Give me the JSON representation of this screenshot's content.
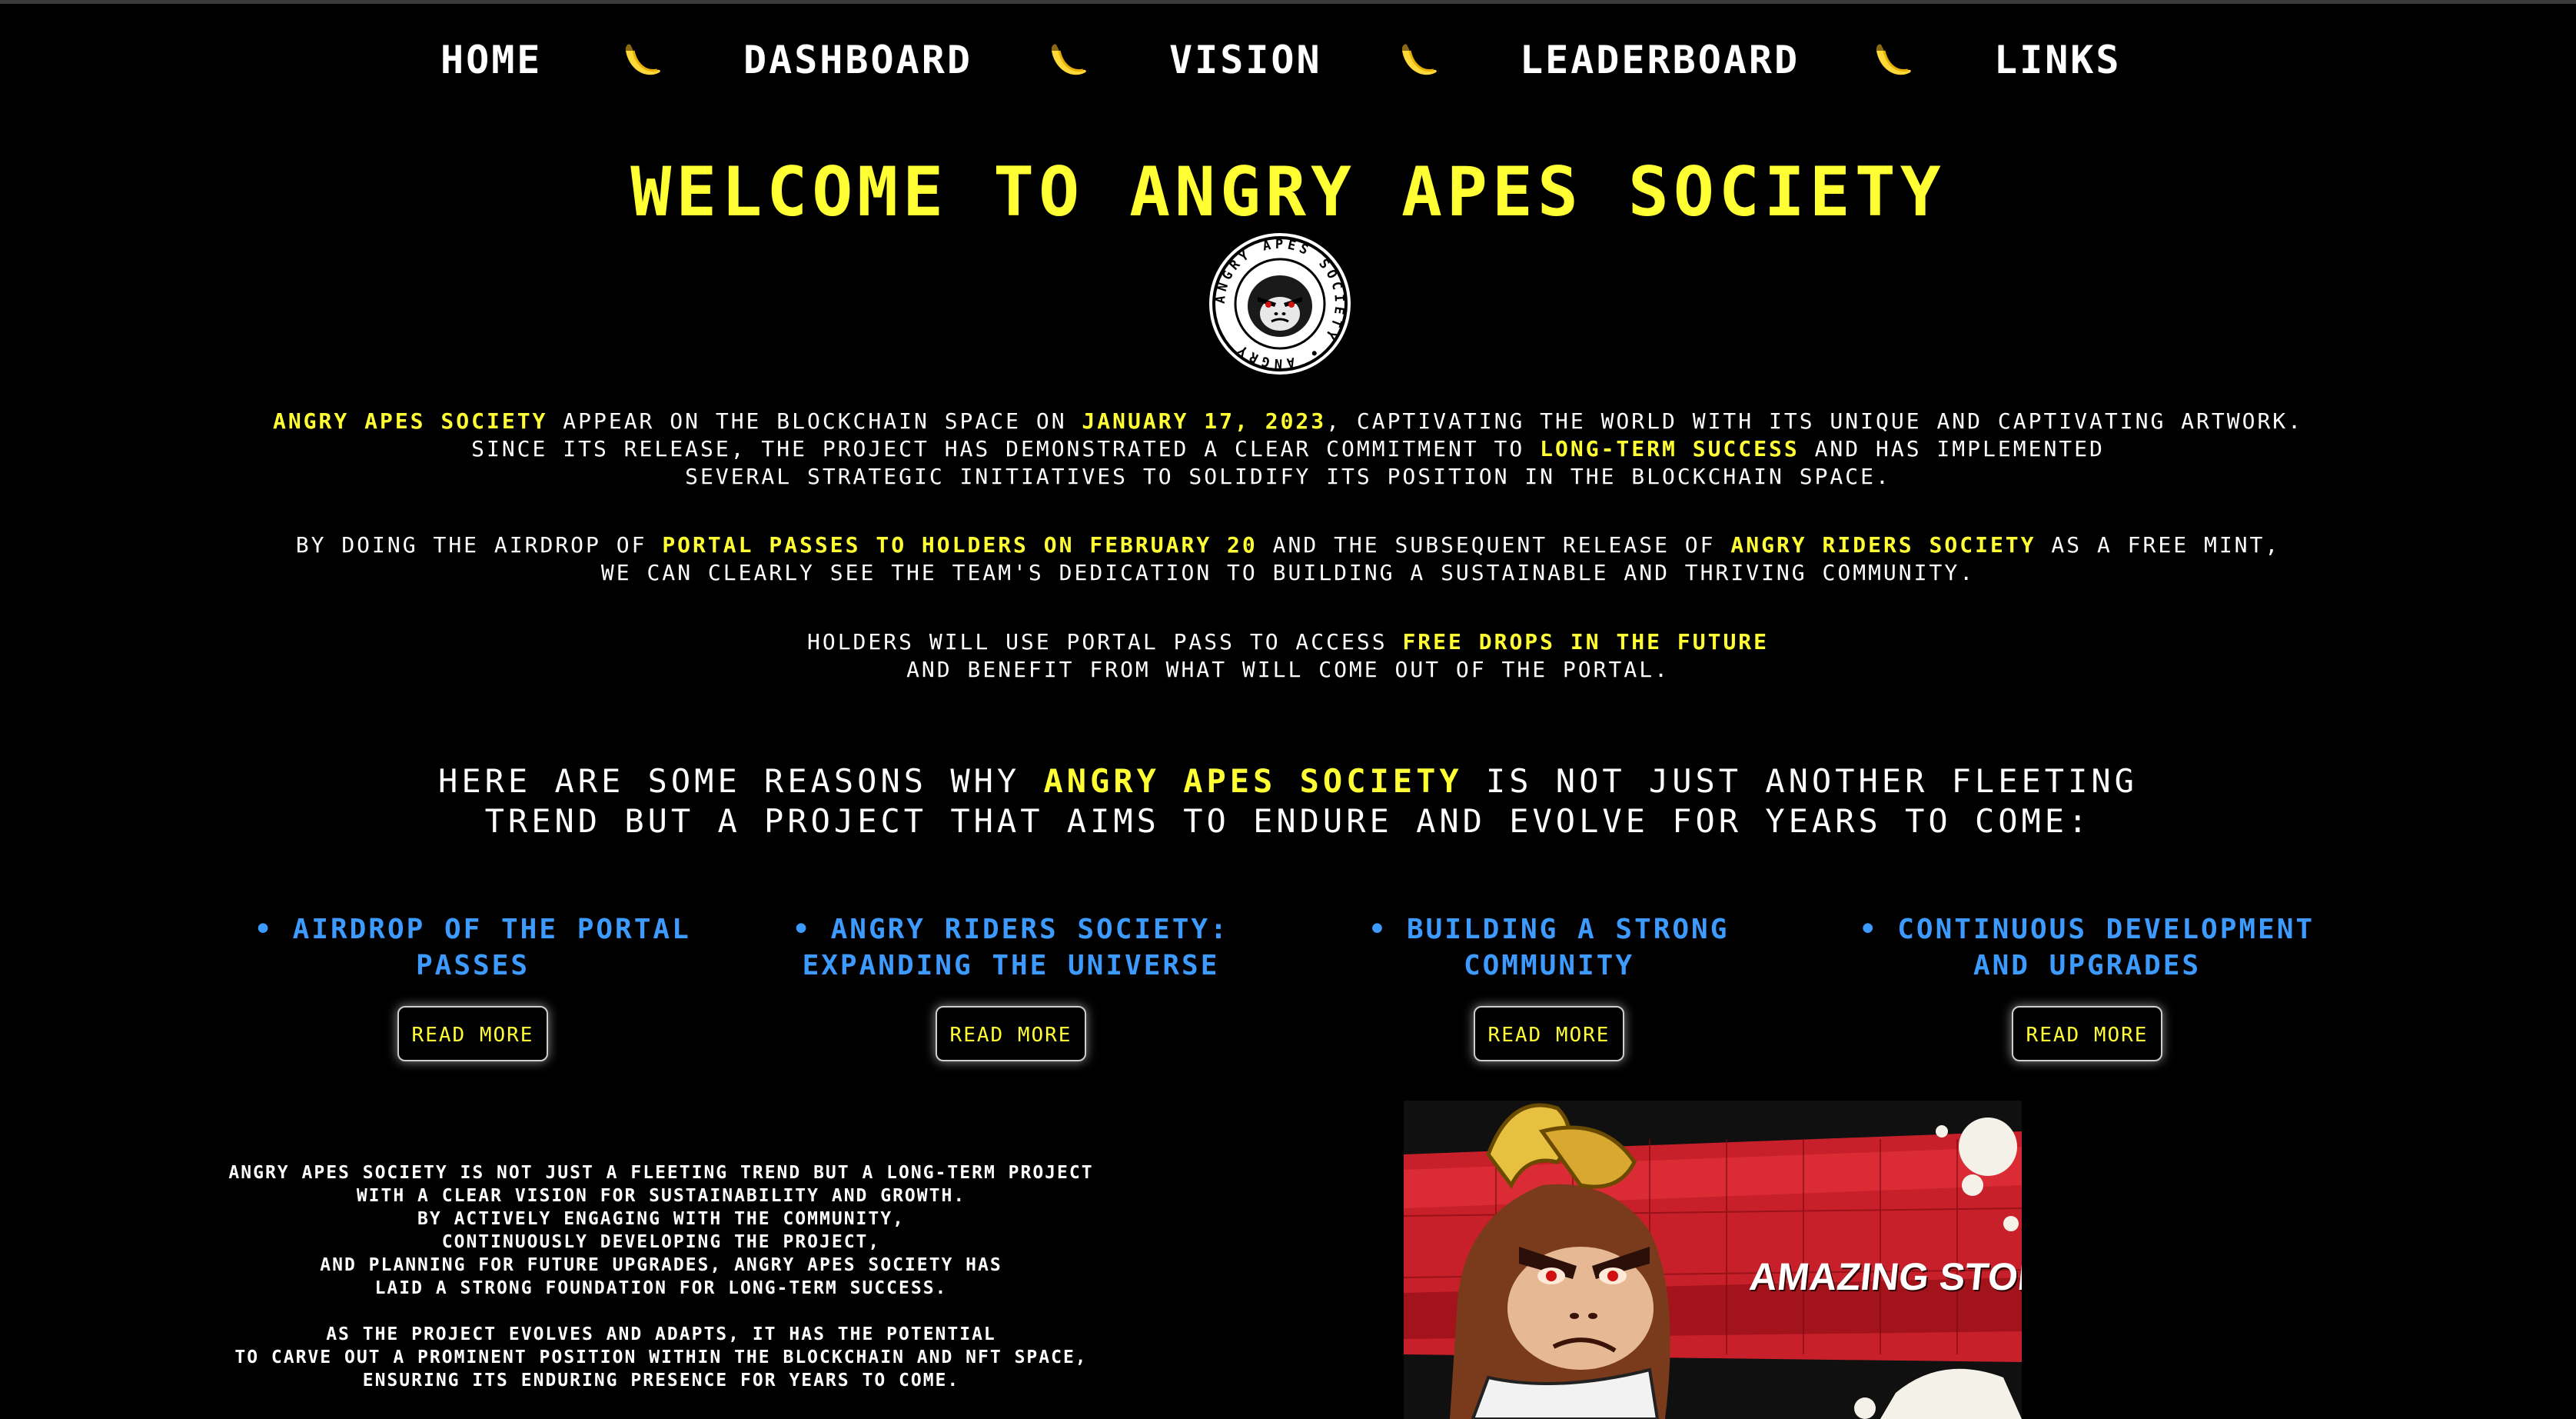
{
  "nav": {
    "items": [
      {
        "label": "HOME"
      },
      {
        "label": "DASHBOARD"
      },
      {
        "label": "VISION"
      },
      {
        "label": "LEADERBOARD"
      },
      {
        "label": "LINKS"
      }
    ],
    "separator_icon": "banana-icon"
  },
  "hero": {
    "title": "WELCOME TO ANGRY APES SOCIETY",
    "logo_text": "ANGRY APES SOCIETY"
  },
  "intro": {
    "p1": {
      "l1a": "ANGRY APES SOCIETY",
      "l1b": " APPEAR ON THE BLOCKCHAIN SPACE ON ",
      "l1c": "JANUARY 17, 2023",
      "l1d": ", CAPTIVATING THE WORLD WITH ITS UNIQUE AND CAPTIVATING ARTWORK.",
      "l2a": "SINCE ITS RELEASE, THE PROJECT HAS DEMONSTRATED A CLEAR COMMITMENT TO ",
      "l2b": "LONG-TERM SUCCESS",
      "l2c": " AND HAS IMPLEMENTED",
      "l3": "SEVERAL STRATEGIC INITIATIVES TO SOLIDIFY ITS POSITION IN THE BLOCKCHAIN SPACE."
    },
    "p2": {
      "l1a": "BY DOING THE AIRDROP OF ",
      "l1b": "PORTAL PASSES TO HOLDERS ON FEBRUARY 20",
      "l1c": " AND THE SUBSEQUENT RELEASE OF ",
      "l1d": "ANGRY RIDERS SOCIETY",
      "l1e": " AS A FREE MINT,",
      "l2": "WE CAN CLEARLY SEE THE TEAM'S DEDICATION TO BUILDING A SUSTAINABLE AND THRIVING COMMUNITY."
    },
    "p3": {
      "l1a": "HOLDERS WILL USE PORTAL PASS TO ACCESS ",
      "l1b": "FREE DROPS IN THE FUTURE",
      "l2": "AND BENEFIT FROM WHAT WILL COME OUT OF THE PORTAL."
    }
  },
  "reasons": {
    "l1a": "HERE ARE SOME REASONS WHY ",
    "l1b": "ANGRY APES SOCIETY",
    "l1c": " IS NOT JUST ANOTHER FLEETING",
    "l2": "TREND BUT A PROJECT THAT AIMS TO ENDURE AND EVOLVE FOR YEARS TO COME:"
  },
  "features": [
    {
      "line1": "• AIRDROP OF THE PORTAL",
      "line2": "PASSES",
      "button": "READ MORE"
    },
    {
      "line1": "• ANGRY RIDERS SOCIETY:",
      "line2": "EXPANDING THE UNIVERSE",
      "button": "READ MORE"
    },
    {
      "line1": "• BUILDING A STRONG",
      "line2": "COMMUNITY",
      "button": "READ MORE"
    },
    {
      "line1": "• CONTINUOUS DEVELOPMENT",
      "line2": "AND UPGRADES",
      "button": "READ MORE"
    }
  ],
  "bottom": {
    "lines": [
      "ANGRY APES SOCIETY IS NOT JUST A FLEETING TREND BUT A LONG-TERM PROJECT",
      "WITH A CLEAR VISION FOR SUSTAINABILITY AND GROWTH.",
      "BY ACTIVELY ENGAGING WITH THE COMMUNITY,",
      "CONTINUOUSLY DEVELOPING THE PROJECT,",
      "AND PLANNING FOR FUTURE UPGRADES, ANGRY APES SOCIETY HAS",
      "LAID A STRONG FOUNDATION FOR LONG-TERM SUCCESS."
    ],
    "lines2": [
      "AS THE PROJECT EVOLVES AND ADAPTS, IT HAS THE POTENTIAL",
      "TO CARVE OUT A PROMINENT POSITION WITHIN THE BLOCKCHAIN AND NFT SPACE,",
      "ENSURING ITS ENDURING PRESENCE FOR YEARS TO COME."
    ]
  },
  "story": {
    "caption": "AMAZING STORY"
  },
  "colors": {
    "background": "#000000",
    "accent_yellow": "#ffff33",
    "feature_blue": "#3d9bff",
    "text": "#ffffff"
  }
}
